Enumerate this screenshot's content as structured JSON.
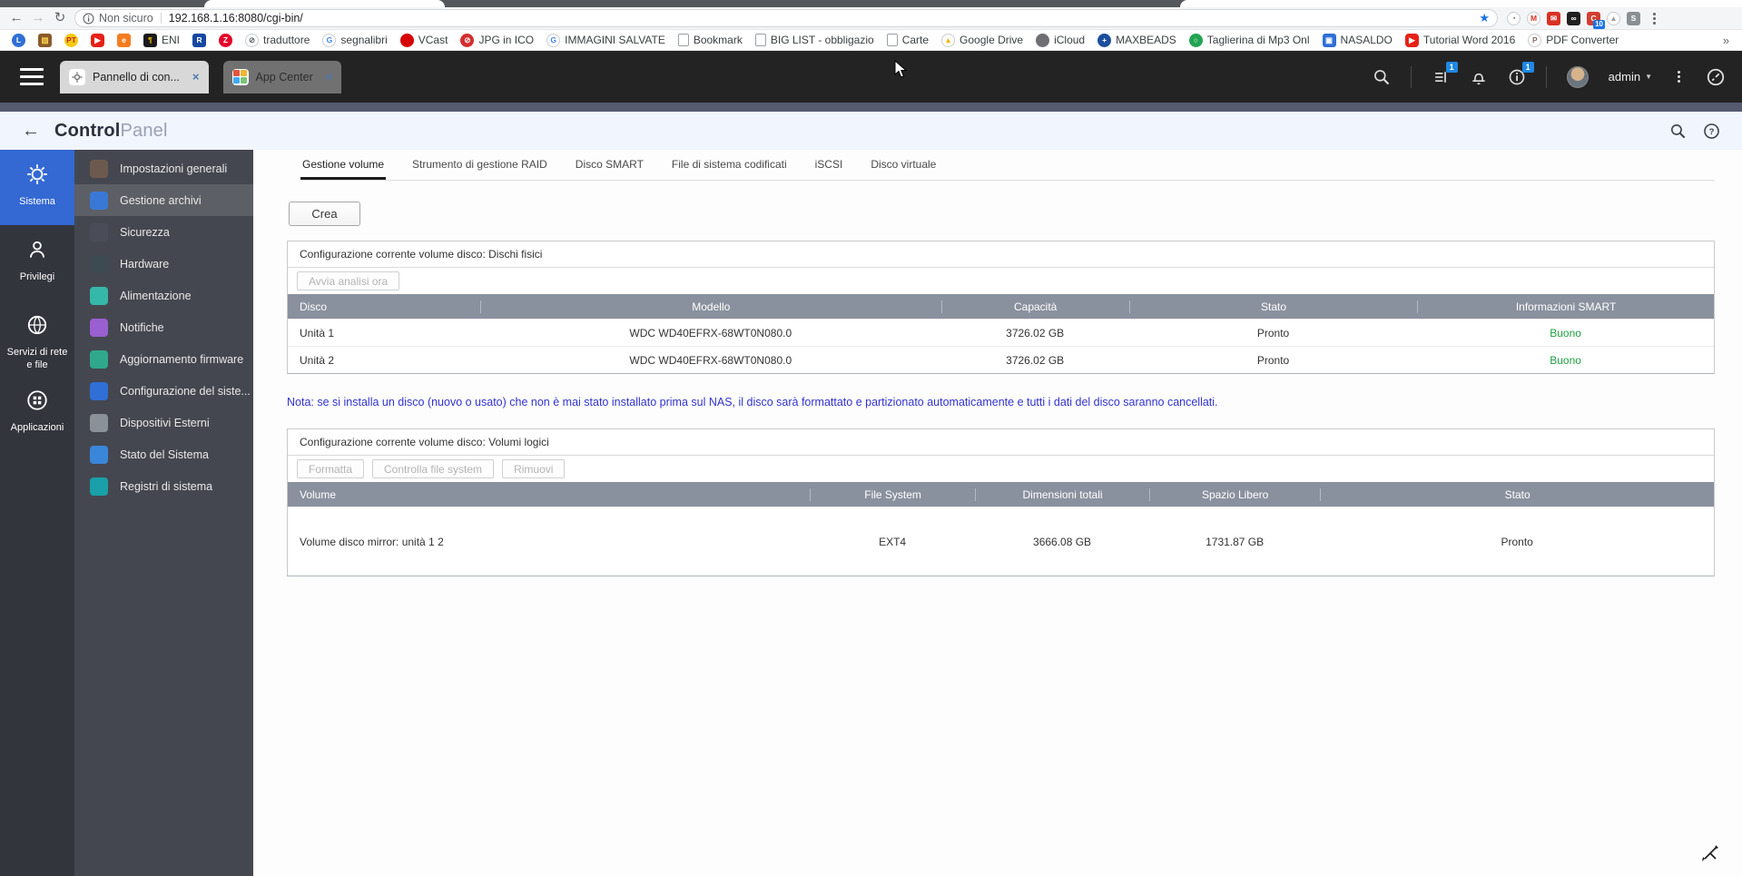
{
  "colors": {
    "accent_blue": "#3468d2",
    "badge_blue": "#1e88e5",
    "smart_good_green": "#1f9e40",
    "note_blue": "#3233cf",
    "table_header_grey": "#8a919e"
  },
  "browser": {
    "security_label": "Non sicuro",
    "url": "192.168.1.16:8080/cgi-bin/",
    "extensions": [
      {
        "name": "timer-extension",
        "shape": "ring",
        "fg": "#5f6368",
        "letter": "◔",
        "badge": ""
      },
      {
        "name": "gmail-extension",
        "shape": "ring",
        "fg": "#d93025",
        "letter": "M",
        "badge": ""
      },
      {
        "name": "mail-extension",
        "shape": "square",
        "color": "#d93025",
        "fg": "#fff",
        "letter": "✉",
        "badge": ""
      },
      {
        "name": "mask-extension",
        "shape": "square",
        "color": "#1f1f1f",
        "fg": "#fff",
        "letter": "∞",
        "badge": ""
      },
      {
        "name": "c-extension",
        "shape": "square",
        "color": "#d23f31",
        "fg": "#fff",
        "letter": "C",
        "badge": "10"
      },
      {
        "name": "drive-offline-extension",
        "shape": "ring",
        "fg": "#9aa0a6",
        "letter": "▲",
        "badge": ""
      },
      {
        "name": "s-extension",
        "shape": "square",
        "color": "#8a8f94",
        "fg": "#fff",
        "letter": "S",
        "badge": ""
      }
    ],
    "bookmarks": [
      {
        "shape": "circle",
        "color": "#2f6fd6",
        "fg": "#fff",
        "letter": "L",
        "label": ""
      },
      {
        "shape": "square",
        "color": "#8a5a2a",
        "fg": "#ffd54f",
        "letter": "▥",
        "label": ""
      },
      {
        "shape": "circle",
        "color": "#f6c915",
        "fg": "#c62828",
        "letter": "PT",
        "label": ""
      },
      {
        "shape": "play",
        "color": "#e62117",
        "fg": "#fff",
        "letter": "▶",
        "label": ""
      },
      {
        "shape": "square",
        "color": "#f57d20",
        "fg": "#fff",
        "letter": "e",
        "label": ""
      },
      {
        "shape": "square",
        "color": "#1a1a1a",
        "fg": "#f2c200",
        "letter": "¶",
        "label": "ENI"
      },
      {
        "shape": "square",
        "color": "#1547a3",
        "fg": "#fff",
        "letter": "R",
        "label": ""
      },
      {
        "shape": "circle",
        "color": "#e4002b",
        "fg": "#fff",
        "letter": "Z",
        "label": ""
      },
      {
        "shape": "ring",
        "fg": "#5f6368",
        "letter": "⊘",
        "label": "traduttore"
      },
      {
        "shape": "ring",
        "fg": "#4285f4",
        "letter": "G",
        "label": "segnalibri"
      },
      {
        "shape": "circle",
        "color": "#d50000",
        "fg": "#d50000",
        "letter": "",
        "label": "VCast"
      },
      {
        "shape": "circle",
        "color": "#d32f2f",
        "fg": "#fff",
        "letter": "⊘",
        "label": "JPG in ICO"
      },
      {
        "shape": "ring",
        "fg": "#4285f4",
        "letter": "G",
        "label": "IMMAGINI SALVATE"
      },
      {
        "shape": "doc",
        "letter": "",
        "label": "Bookmark"
      },
      {
        "shape": "doc",
        "letter": "",
        "label": "BIG LIST - obbligazio"
      },
      {
        "shape": "doc",
        "letter": "",
        "label": "Carte"
      },
      {
        "shape": "ring",
        "fg": "#f4b400",
        "letter": "▲",
        "label": "Google Drive"
      },
      {
        "shape": "circle",
        "color": "#6e6e73",
        "fg": "#fff",
        "letter": "",
        "label": "iCloud"
      },
      {
        "shape": "circle",
        "color": "#1b4f9c",
        "fg": "#fff",
        "letter": "+",
        "label": "MAXBEADS"
      },
      {
        "shape": "circle",
        "color": "#21a453",
        "fg": "#fff",
        "letter": "○",
        "label": "Taglierina di Mp3 Onl"
      },
      {
        "shape": "square",
        "color": "#2f6fd6",
        "fg": "#fff",
        "letter": "▣",
        "label": "NASALDO"
      },
      {
        "shape": "play",
        "color": "#e62117",
        "fg": "#fff",
        "letter": "▶",
        "label": "Tutorial Word 2016"
      },
      {
        "shape": "ring",
        "fg": "#8d6e63",
        "letter": "P",
        "label": "PDF Converter"
      }
    ],
    "overflow_chevron": "»"
  },
  "qnap_bar": {
    "tabs": [
      {
        "label": "Pannello di con...",
        "close": "×"
      },
      {
        "label": "App Center",
        "close": "×"
      }
    ],
    "task_badge": "1",
    "info_badge": "1",
    "admin_label": "admin",
    "admin_caret": "▼"
  },
  "cp": {
    "title_bold": "Control",
    "title_light": "Panel",
    "back_arrow": "←",
    "rail": [
      {
        "label": "Sistema"
      },
      {
        "label": "Privilegi"
      },
      {
        "label": "Servizi di rete e file"
      },
      {
        "label": "Applicazioni"
      }
    ],
    "menu": [
      {
        "label": "Impostazioni generali",
        "color": "#6d5a4e",
        "state": ""
      },
      {
        "label": "Gestione archivi",
        "color": "#3a78d6",
        "state": "selected"
      },
      {
        "label": "Sicurezza",
        "color": "#4a4d57",
        "state": ""
      },
      {
        "label": "Hardware",
        "color": "#3e4a52",
        "state": ""
      },
      {
        "label": "Alimentazione",
        "color": "#35b8a8",
        "state": ""
      },
      {
        "label": "Notifiche",
        "color": "#9a5fd0",
        "state": ""
      },
      {
        "label": "Aggiornamento firmware",
        "color": "#2fa88c",
        "state": ""
      },
      {
        "label": "Configurazione del siste...",
        "color": "#2f6fd6",
        "state": ""
      },
      {
        "label": "Dispositivi Esterni",
        "color": "#8a9298",
        "state": ""
      },
      {
        "label": "Stato del Sistema",
        "color": "#3a86d8",
        "state": ""
      },
      {
        "label": "Registri di sistema",
        "color": "#19a0a8",
        "state": ""
      }
    ],
    "tabs": [
      {
        "label": "Gestione volume",
        "state": "active"
      },
      {
        "label": "Strumento di gestione RAID",
        "state": ""
      },
      {
        "label": "Disco SMART",
        "state": ""
      },
      {
        "label": "File di sistema codificati",
        "state": ""
      },
      {
        "label": "iSCSI",
        "state": ""
      },
      {
        "label": "Disco virtuale",
        "state": ""
      }
    ],
    "crea_label": "Crea",
    "table1": {
      "title": "Configurazione corrente volume disco: Dischi fisici",
      "button": "Avvia analisi ora",
      "headers": [
        "Disco",
        "Modello",
        "Capacità",
        "Stato",
        "Informazioni SMART"
      ],
      "rows": [
        [
          "Unità 1",
          "WDC WD40EFRX-68WT0N080.0",
          "3726.02 GB",
          "Pronto",
          "Buono"
        ],
        [
          "Unità 2",
          "WDC WD40EFRX-68WT0N080.0",
          "3726.02 GB",
          "Pronto",
          "Buono"
        ]
      ]
    },
    "note": "Nota: se si installa un disco (nuovo o usato) che non è mai stato installato prima sul NAS, il disco sarà formattato e partizionato automaticamente e tutti i dati del disco saranno cancellati.",
    "table2": {
      "title": "Configurazione corrente volume disco: Volumi logici",
      "buttons": [
        "Formatta",
        "Controlla file system",
        "Rimuovi"
      ],
      "headers": [
        "Volume",
        "File System",
        "Dimensioni totali",
        "Spazio Libero",
        "Stato"
      ],
      "rows": [
        [
          "Volume disco mirror: unità 1 2",
          "EXT4",
          "3666.08 GB",
          "1731.87 GB",
          "Pronto"
        ]
      ]
    }
  }
}
